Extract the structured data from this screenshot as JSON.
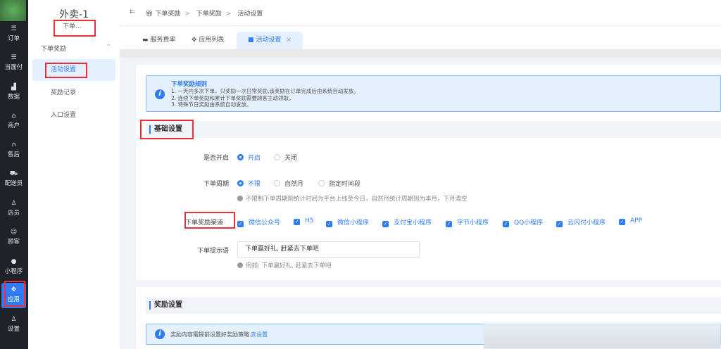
{
  "nav": {
    "items": [
      {
        "label": "订单",
        "icon": "list-icon"
      },
      {
        "label": "当面付",
        "icon": "list-icon"
      },
      {
        "label": "数据",
        "icon": "bar-chart-icon"
      },
      {
        "label": "商户",
        "icon": "store-icon"
      },
      {
        "label": "售后",
        "icon": "headset-icon"
      },
      {
        "label": "配送员",
        "icon": "delivery-icon"
      },
      {
        "label": "店员",
        "icon": "staff-icon"
      },
      {
        "label": "顾客",
        "icon": "customer-icon"
      },
      {
        "label": "小程序",
        "icon": "wechat-icon"
      },
      {
        "label": "应用",
        "icon": "apps-icon",
        "active": true
      },
      {
        "label": "设置",
        "icon": "settings-icon"
      }
    ]
  },
  "side": {
    "title": "外卖-1",
    "subtitle": "下单...",
    "group": "下单奖励",
    "items": [
      {
        "label": "活动设置",
        "active": true
      },
      {
        "label": "奖励记录"
      },
      {
        "label": "入口设置"
      }
    ]
  },
  "breadcrumb": [
    "下单奖励",
    "下单奖励",
    "活动设置"
  ],
  "tabs": [
    {
      "label": "服务费率"
    },
    {
      "label": "应用列表"
    },
    {
      "label": "活动设置",
      "active": true,
      "close": "×"
    }
  ],
  "rules": {
    "title": "下单奖励规则",
    "lines": [
      "1. 一天内多次下单，只奖励一次日常奖励,该奖励在订单完成后由系统自动发放。",
      "2. 连续下单奖励和累计下单奖励需要顾客主动领取。",
      "3. 特殊节日奖励由系统自动发放。"
    ]
  },
  "basic": {
    "title": "基础设置",
    "enable": {
      "label": "是否开启",
      "options": [
        "开启",
        "关闭"
      ],
      "selected": "开启"
    },
    "period": {
      "label": "下单周期",
      "options": [
        "不限",
        "自然月",
        "指定时间段"
      ],
      "selected": "不限",
      "hint": "不限制下单周期则统计时间为平台上线至今日，自然月统计周期则为本月，下月清空"
    },
    "channels": {
      "label": "下单奖励渠道",
      "options": [
        "微信公众号",
        "H5",
        "微信小程序",
        "支付宝小程序",
        "字节小程序",
        "QQ小程序",
        "云闪付小程序",
        "APP"
      ],
      "checked": [
        true,
        true,
        true,
        true,
        true,
        true,
        true,
        true
      ]
    },
    "prompt": {
      "label": "下单提示语",
      "value": "下单赢好礼, 赶紧去下单吧",
      "hint": "例如: 下单赢好礼, 赶紧去下单吧"
    }
  },
  "reward": {
    "title": "奖励设置",
    "notice": "奖励内容需提前设置好奖励策略.",
    "link": "去设置"
  },
  "colors": {
    "accent": "#2f7cf6",
    "nav_bg": "#1f2229",
    "highlight": "#e8303a"
  }
}
